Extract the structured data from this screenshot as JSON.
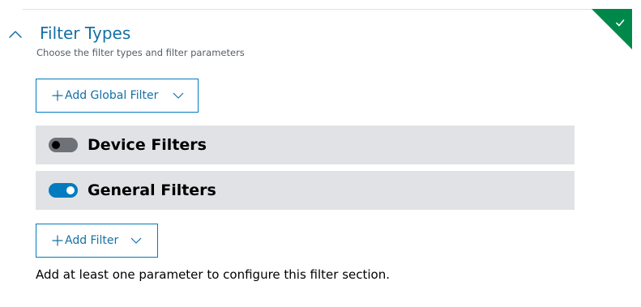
{
  "section": {
    "title": "Filter Types",
    "subtitle": "Choose the filter types and filter parameters",
    "status": "complete",
    "status_color": "#00884a",
    "accent_color": "#007bc0"
  },
  "add_global_filter": {
    "label": "Add Global Filter",
    "icon": "plus-icon",
    "dropdown_icon": "chevron-down-icon"
  },
  "filter_groups": [
    {
      "label": "Device Filters",
      "enabled": false
    },
    {
      "label": "General Filters",
      "enabled": true
    }
  ],
  "add_filter": {
    "label": "Add Filter",
    "icon": "plus-icon",
    "dropdown_icon": "chevron-down-icon"
  },
  "helper_text": "Add at least one parameter to configure this filter section."
}
